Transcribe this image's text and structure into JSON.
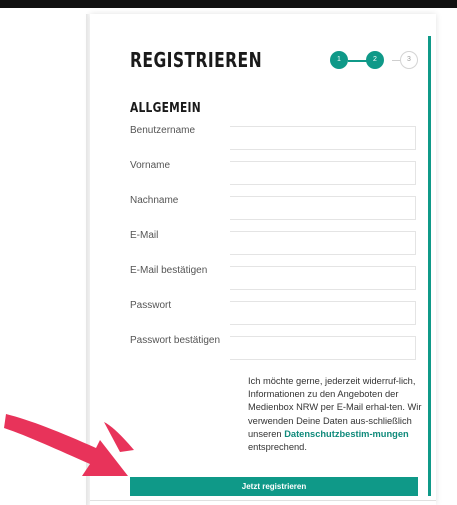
{
  "form": {
    "title": "REGISTRIEREN",
    "section_title": "ALLGEMEIN",
    "steps": [
      "1",
      "2",
      "3"
    ],
    "current_step": 2,
    "fields": [
      {
        "label": "Benutzername",
        "value": ""
      },
      {
        "label": "Vorname",
        "value": ""
      },
      {
        "label": "Nachname",
        "value": ""
      },
      {
        "label": "E-Mail",
        "value": ""
      },
      {
        "label": "E-Mail bestätigen",
        "value": ""
      },
      {
        "label": "Passwort",
        "value": ""
      },
      {
        "label": "Passwort bestätigen",
        "value": ""
      }
    ],
    "consent": {
      "text": "Ich möchte gerne, jederzeit widerruf-lich, Informationen zu den Angeboten der Medienbox NRW per E-Mail erhal-ten. Wir verwenden Deine Daten aus-schließlich unseren",
      "link": "Datenschutzbestim-mungen",
      "suffix": "entsprechend."
    },
    "submit_label": "Jetzt registrieren"
  },
  "colors": {
    "accent": "#0f9988",
    "arrow": "#e8335a",
    "text": "#1a1a1a"
  },
  "icons": {
    "annotation": "pink-arrow-icon"
  }
}
